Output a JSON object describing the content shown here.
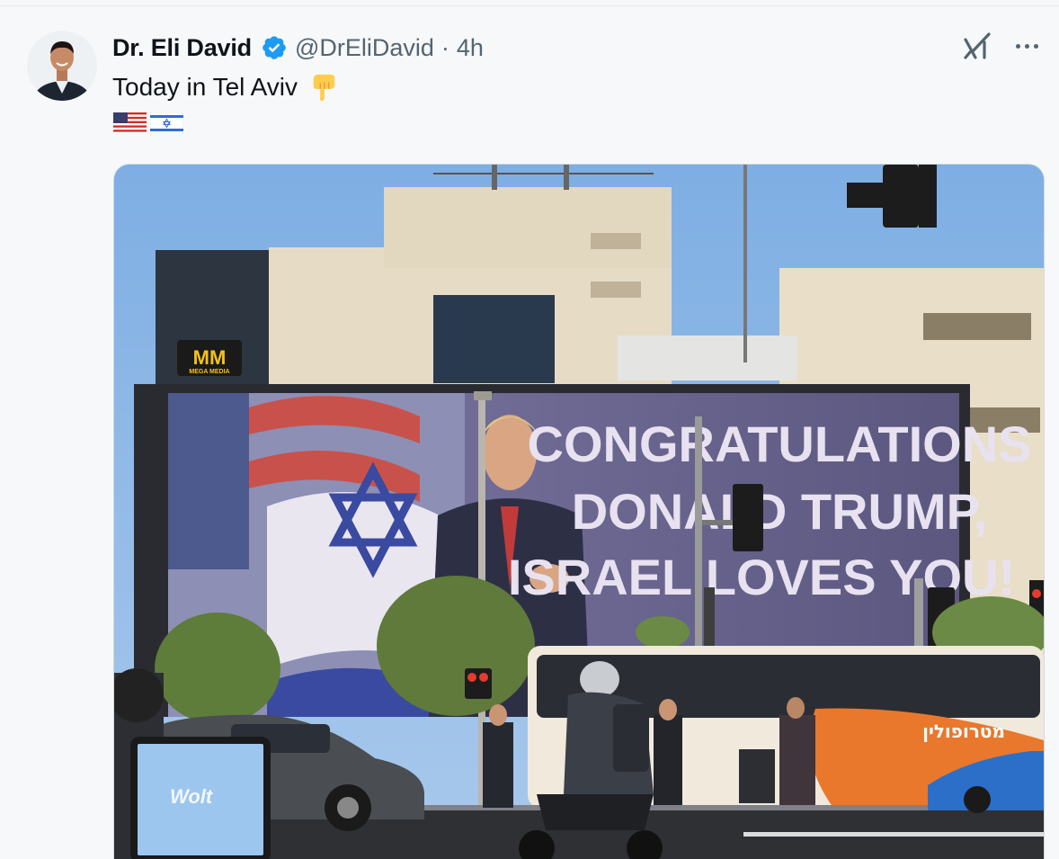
{
  "tweet": {
    "author_name": "Dr. Eli David",
    "handle": "@DrEliDavid",
    "separator": "·",
    "time": "4h",
    "text": "Today in Tel Aviv",
    "text_emoji": "pointing-down-emoji",
    "flags": [
      "us-flag-emoji",
      "israel-flag-emoji"
    ]
  },
  "media": {
    "billboard": {
      "line1": "CONGRATULATIONS",
      "line2": "DONALD TRUMP,",
      "line3": "ISRAEL LOVES YOU!"
    },
    "sign_logo": "MM",
    "sign_sub": "MEGA MEDIA",
    "bag_text": "Wolt",
    "bus_text": "מטרופולין"
  },
  "colors": {
    "verified_blue": "#1d9bf0",
    "secondary_text": "#536471",
    "primary_text": "#0f1419"
  }
}
